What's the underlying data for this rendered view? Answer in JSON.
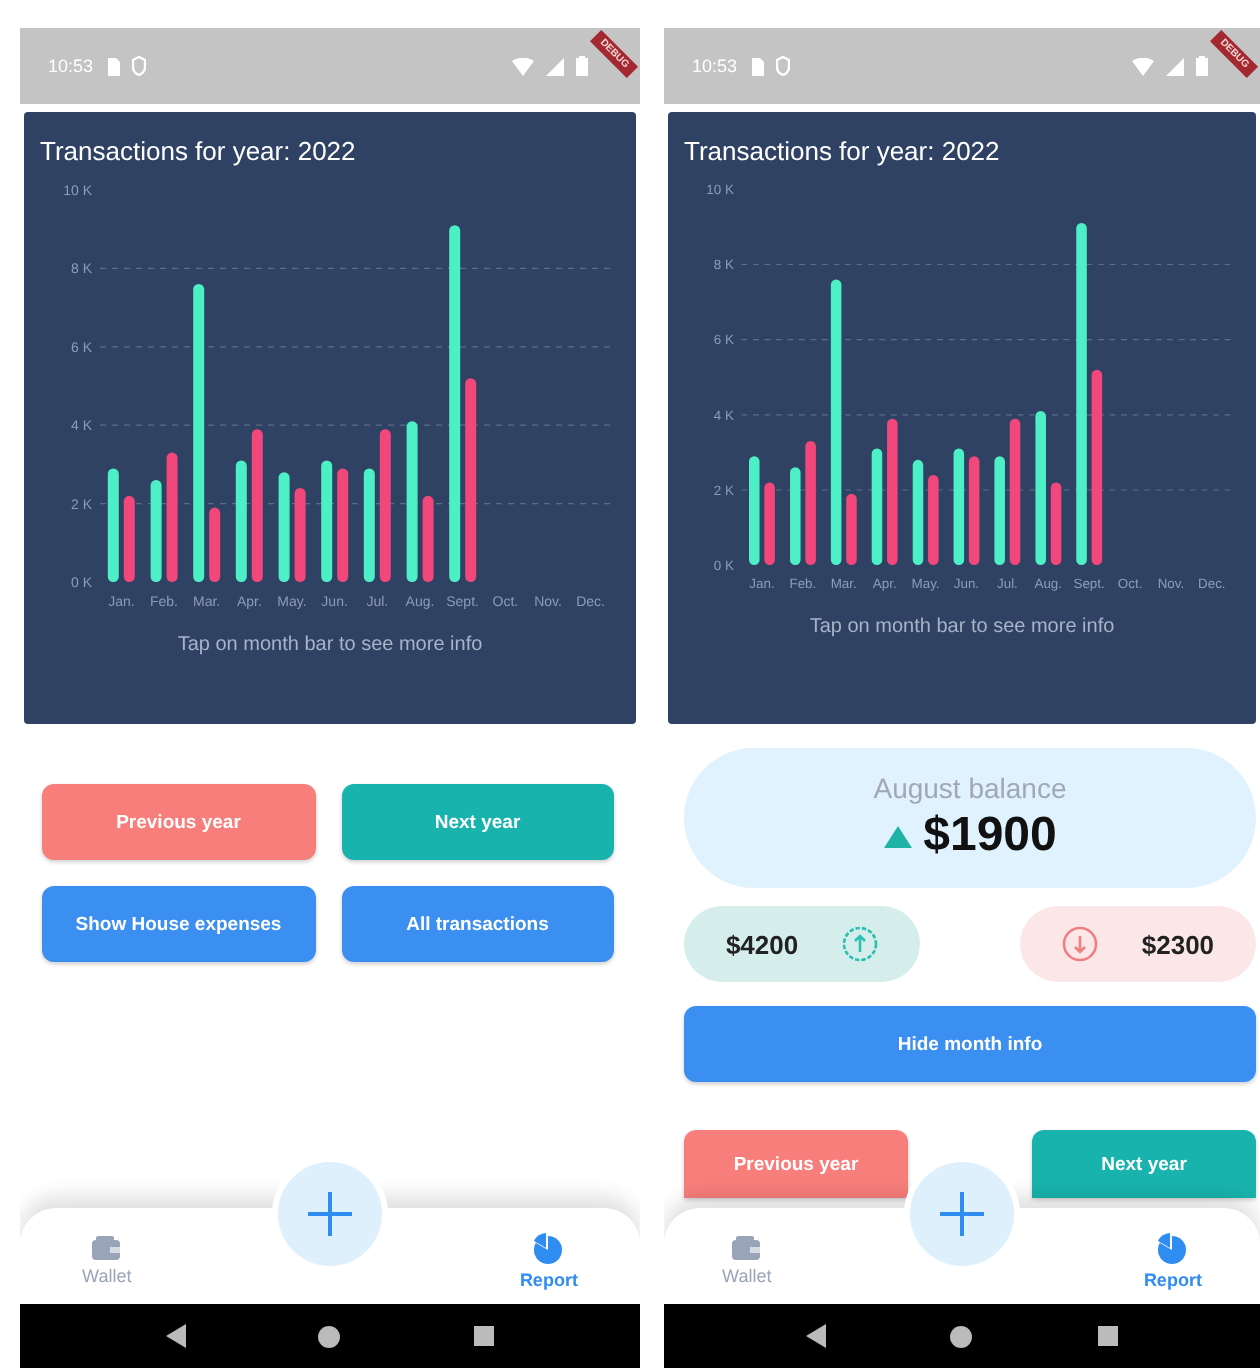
{
  "phones": [
    {
      "status_bar": {
        "time": "10:53"
      },
      "debug_banner": "DEBUG",
      "chart_card": {
        "title": "Transactions for year: 2022",
        "hint": "Tap on month bar to see more info",
        "chart_data": {
          "type": "bar",
          "categories": [
            "Jan.",
            "Feb.",
            "Mar.",
            "Apr.",
            "May.",
            "Jun.",
            "Jul.",
            "Aug.",
            "Sept.",
            "Oct.",
            "Nov.",
            "Dec."
          ],
          "series": [
            {
              "color": "#4df0c6",
              "values": [
                2900,
                2600,
                7600,
                3100,
                2800,
                3100,
                2900,
                4100,
                9100,
                null,
                null,
                null
              ]
            },
            {
              "color": "#f2477a",
              "values": [
                2200,
                3300,
                1900,
                3900,
                2400,
                2900,
                3900,
                2200,
                5200,
                null,
                null,
                null
              ]
            }
          ],
          "ylim": [
            0,
            10000
          ],
          "grid": true,
          "yticks": [
            {
              "value": 0,
              "label": "0 K"
            },
            {
              "value": 2000,
              "label": "2 K"
            },
            {
              "value": 4000,
              "label": "4 K"
            },
            {
              "value": 6000,
              "label": "6 K"
            },
            {
              "value": 8000,
              "label": "8 K"
            },
            {
              "value": 10000,
              "label": "10 K"
            }
          ]
        }
      },
      "buttons": [
        {
          "label": "Previous year",
          "color": "#f77e7b"
        },
        {
          "label": "Next year",
          "color": "#19b3ad"
        },
        {
          "label": "Show House expenses",
          "color": "#3b8ff0"
        },
        {
          "label": "All transactions",
          "color": "#3b8ff0"
        }
      ],
      "bottom_nav": {
        "items": [
          {
            "label": "Wallet",
            "kind": "wallet",
            "selected": false
          },
          {
            "label": "Report",
            "kind": "report",
            "selected": true
          }
        ]
      }
    },
    {
      "status_bar": {
        "time": "10:53"
      },
      "debug_banner": "DEBUG",
      "chart_card": {
        "title": "Transactions for year: 2022",
        "hint": "Tap on month bar to see more info",
        "chart_data": {
          "type": "bar",
          "categories": [
            "Jan.",
            "Feb.",
            "Mar.",
            "Apr.",
            "May.",
            "Jun.",
            "Jul.",
            "Aug.",
            "Sept.",
            "Oct.",
            "Nov.",
            "Dec."
          ],
          "series": [
            {
              "color": "#4df0c6",
              "values": [
                2900,
                2600,
                7600,
                3100,
                2800,
                3100,
                2900,
                4100,
                9100,
                null,
                null,
                null
              ]
            },
            {
              "color": "#f2477a",
              "values": [
                2200,
                3300,
                1900,
                3900,
                2400,
                2900,
                3900,
                2200,
                5200,
                null,
                null,
                null
              ]
            }
          ],
          "ylim": [
            0,
            10000
          ],
          "grid": true,
          "yticks": [
            {
              "value": 0,
              "label": "0 K"
            },
            {
              "value": 2000,
              "label": "2 K"
            },
            {
              "value": 4000,
              "label": "4 K"
            },
            {
              "value": 6000,
              "label": "6 K"
            },
            {
              "value": 8000,
              "label": "8 K"
            },
            {
              "value": 10000,
              "label": "10 K"
            }
          ]
        }
      },
      "month_info": {
        "title": "August balance",
        "balance": "$1900",
        "balance_up": true,
        "income": "$4200",
        "expense": "$2300",
        "hide_button": "Hide month info"
      },
      "buttons": [
        {
          "label": "Previous year",
          "color": "#f77e7b"
        },
        {
          "label": "Next year",
          "color": "#19b3ad"
        }
      ],
      "bottom_nav": {
        "items": [
          {
            "label": "Wallet",
            "kind": "wallet",
            "selected": false
          },
          {
            "label": "Report",
            "kind": "report",
            "selected": true
          }
        ]
      }
    }
  ]
}
